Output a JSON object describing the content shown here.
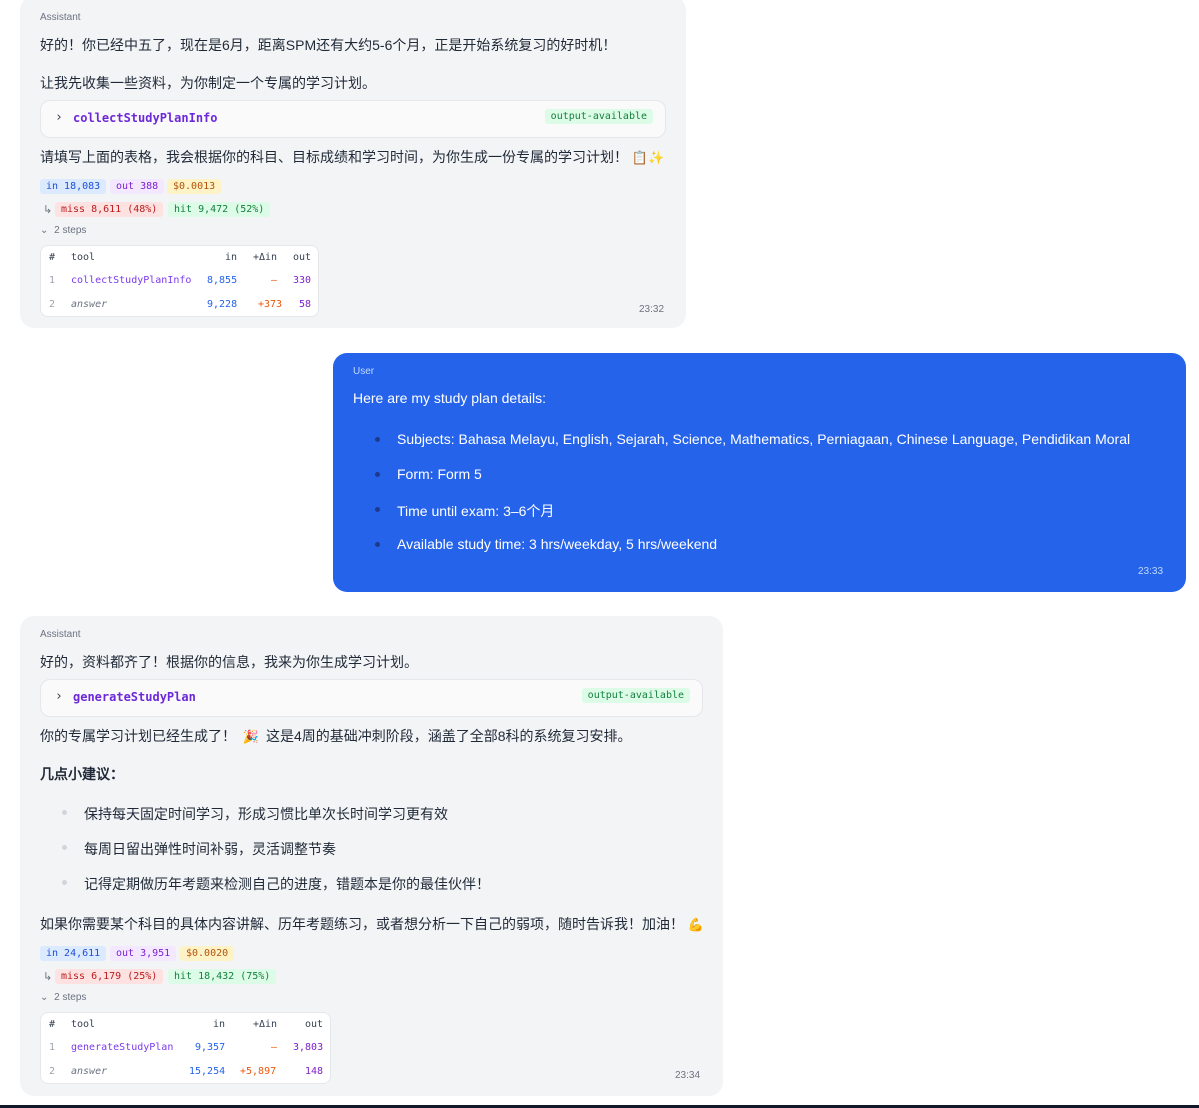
{
  "msg1": {
    "role": "Assistant",
    "line1": "好的！你已经中五了，现在是6月，距离SPM还有大约5-6个月，正是开始系统复习的好时机！",
    "line2": "让我先收集一些资料，为你制定一个专属的学习计划。",
    "tool_name": "collectStudyPlanInfo",
    "tool_status": "output-available",
    "line3": "请填写上面的表格，我会根据你的科目、目标成绩和学习时间，为你生成一份专属的学习计划！",
    "emoji3": "📋✨",
    "badges": {
      "in": "in 18,083",
      "out": "out 388",
      "cost": "$0.0013",
      "miss": "miss 8,611 (48%)",
      "hit": "hit 9,472 (52%)"
    },
    "hook": "↳",
    "steps_label": "2 steps",
    "table": {
      "headers": {
        "num": "#",
        "tool": "tool",
        "in": "in",
        "delta": "+Δin",
        "out": "out"
      },
      "rows": [
        {
          "num": "1",
          "tool": "collectStudyPlanInfo",
          "in": "8,855",
          "delta": "–",
          "out": "330"
        },
        {
          "num": "2",
          "tool": "answer",
          "in": "9,228",
          "delta": "+373",
          "out": "58"
        }
      ]
    },
    "time": "23:32"
  },
  "msg2": {
    "role": "User",
    "intro": "Here are my study plan details:",
    "items": [
      "Subjects: Bahasa Melayu, English, Sejarah, Science, Mathematics, Perniagaan, Chinese Language, Pendidikan Moral",
      "Form: Form 5",
      "Time until exam: 3–6个月",
      "Available study time: 3 hrs/weekday, 5 hrs/weekend"
    ],
    "time": "23:33"
  },
  "msg3": {
    "role": "Assistant",
    "line1": "好的，资料都齐了！根据你的信息，我来为你生成学习计划。",
    "tool_name": "generateStudyPlan",
    "tool_status": "output-available",
    "line2": "你的专属学习计划已经生成了！",
    "emoji2": "🎉",
    "line2b": "这是4周的基础冲刺阶段，涵盖了全部8科的系统复习安排。",
    "heading": "几点小建议：",
    "tips": [
      "保持每天固定时间学习，形成习惯比单次长时间学习更有效",
      "每周日留出弹性时间补弱，灵活调整节奏",
      "记得定期做历年考题来检测自己的进度，错题本是你的最佳伙伴！"
    ],
    "line3": "如果你需要某个科目的具体内容讲解、历年考题练习，或者想分析一下自己的弱项，随时告诉我！加油！",
    "emoji3": "💪",
    "badges": {
      "in": "in 24,611",
      "out": "out 3,951",
      "cost": "$0.0020",
      "miss": "miss 6,179 (25%)",
      "hit": "hit 18,432 (75%)"
    },
    "hook": "↳",
    "steps_label": "2 steps",
    "table": {
      "headers": {
        "num": "#",
        "tool": "tool",
        "in": "in",
        "delta": "+Δin",
        "out": "out"
      },
      "rows": [
        {
          "num": "1",
          "tool": "generateStudyPlan",
          "in": "9,357",
          "delta": "–",
          "out": "3,803"
        },
        {
          "num": "2",
          "tool": "answer",
          "in": "15,254",
          "delta": "+5,897",
          "out": "148"
        }
      ]
    },
    "time": "23:34"
  }
}
